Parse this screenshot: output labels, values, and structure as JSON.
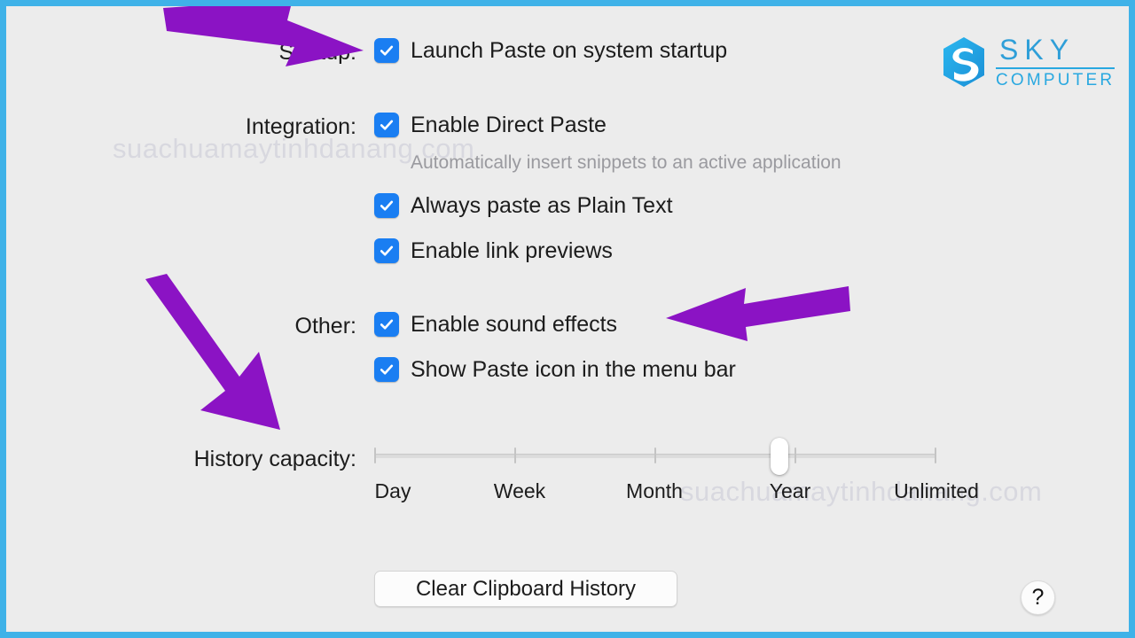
{
  "window": {
    "border_color": "#3fb2e8",
    "background_color": "#ececec"
  },
  "branding": {
    "logo_name": "sky-computer-logo",
    "primary_text": "SKY",
    "secondary_text": "COMPUTER",
    "color": "#29a8e0"
  },
  "watermark": {
    "text": "suachuamaytinhdanang.com"
  },
  "settings": {
    "groups": [
      {
        "label": "Startup:",
        "options": [
          {
            "label": "Launch Paste on system startup",
            "checked": true
          }
        ]
      },
      {
        "label": "Integration:",
        "options": [
          {
            "label": "Enable Direct Paste",
            "checked": true,
            "description": "Automatically insert snippets to an active application"
          },
          {
            "label": "Always paste as Plain Text",
            "checked": true
          },
          {
            "label": "Enable link previews",
            "checked": true
          }
        ]
      },
      {
        "label": "Other:",
        "options": [
          {
            "label": "Enable sound effects",
            "checked": true
          },
          {
            "label": "Show Paste icon in the menu bar",
            "checked": true
          }
        ]
      }
    ],
    "history_capacity": {
      "label": "History capacity:",
      "ticks": [
        "Day",
        "Week",
        "Month",
        "Year",
        "Unlimited"
      ],
      "selected": "Year",
      "selected_index": 3
    }
  },
  "actions": {
    "clear_history_label": "Clear Clipboard History",
    "help_label": "?"
  },
  "annotations": {
    "color": "#8b13c4",
    "arrows": [
      {
        "name": "arrow-pointing-to-startup-checkbox",
        "direction": "right-down"
      },
      {
        "name": "arrow-pointing-to-history-capacity",
        "direction": "down-right"
      },
      {
        "name": "arrow-pointing-to-enable-sound-effects",
        "direction": "left"
      }
    ]
  }
}
